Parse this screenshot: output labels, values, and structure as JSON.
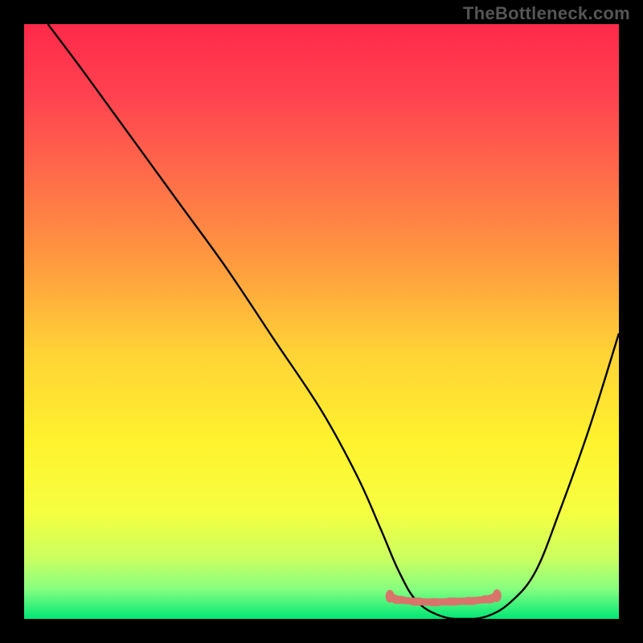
{
  "watermark": "TheBottleneck.com",
  "chart_data": {
    "type": "line",
    "title": "",
    "xlabel": "",
    "ylabel": "",
    "xlim": [
      0,
      100
    ],
    "ylim": [
      0,
      100
    ],
    "background_gradient": {
      "stops": [
        {
          "offset": 0.0,
          "color": "#ff2a4a"
        },
        {
          "offset": 0.12,
          "color": "#ff4250"
        },
        {
          "offset": 0.25,
          "color": "#ff6a4a"
        },
        {
          "offset": 0.4,
          "color": "#ff9a3f"
        },
        {
          "offset": 0.55,
          "color": "#ffd236"
        },
        {
          "offset": 0.7,
          "color": "#fff22e"
        },
        {
          "offset": 0.82,
          "color": "#f6ff40"
        },
        {
          "offset": 0.9,
          "color": "#c9ff61"
        },
        {
          "offset": 0.95,
          "color": "#86ff7f"
        },
        {
          "offset": 1.0,
          "color": "#00e676"
        }
      ]
    },
    "curve": {
      "x": [
        4,
        10,
        18,
        26,
        34,
        42,
        50,
        56,
        60,
        63,
        66,
        70,
        74,
        78,
        82,
        86,
        90,
        95,
        100
      ],
      "y": [
        100,
        92,
        81,
        70,
        59,
        47,
        35,
        24,
        15,
        8,
        3,
        0.5,
        0,
        0.5,
        3,
        8,
        18,
        32,
        48
      ]
    },
    "flat_band": {
      "points": [
        {
          "x": 61.5,
          "y": 96.2
        },
        {
          "x": 63.0,
          "y": 96.8
        },
        {
          "x": 66.0,
          "y": 97.1
        },
        {
          "x": 69.0,
          "y": 97.2
        },
        {
          "x": 72.0,
          "y": 97.1
        },
        {
          "x": 75.0,
          "y": 97.0
        },
        {
          "x": 78.0,
          "y": 96.7
        },
        {
          "x": 79.5,
          "y": 96.1
        }
      ],
      "color": "#d9746b",
      "end_caps": true
    }
  }
}
